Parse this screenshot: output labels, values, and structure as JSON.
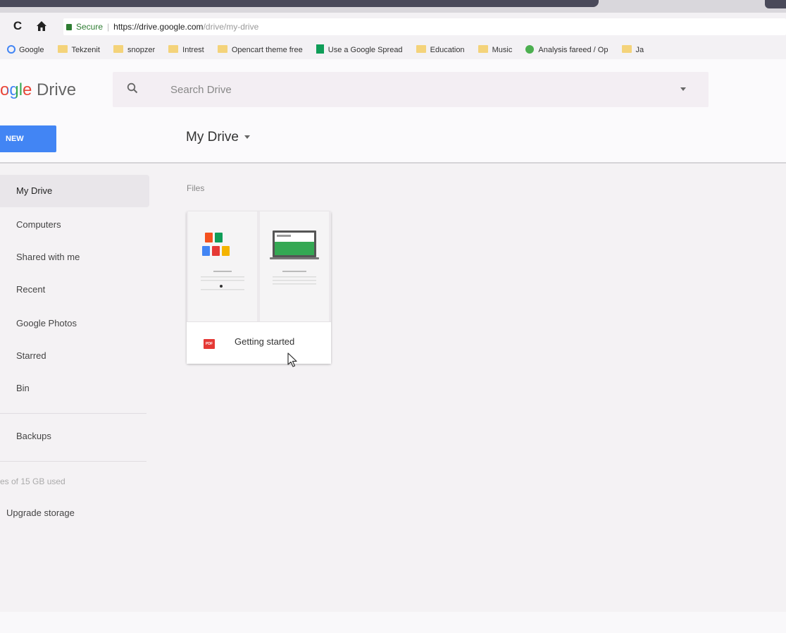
{
  "browser": {
    "secure_label": "Secure",
    "url_host": "https://drive.google.com",
    "url_path": "/drive/my-drive",
    "bookmarks": [
      {
        "label": "Google",
        "icon": "google-icon"
      },
      {
        "label": "Tekzenit",
        "icon": "folder-icon"
      },
      {
        "label": "snopzer",
        "icon": "folder-icon"
      },
      {
        "label": "Intrest",
        "icon": "folder-icon"
      },
      {
        "label": "Opencart theme free",
        "icon": "folder-icon"
      },
      {
        "label": "Use a Google Spread",
        "icon": "sheets-icon"
      },
      {
        "label": "Education",
        "icon": "folder-icon"
      },
      {
        "label": "Music",
        "icon": "folder-icon"
      },
      {
        "label": "Analysis fareed / Op",
        "icon": "app-icon"
      },
      {
        "label": "Ja",
        "icon": "folder-icon"
      }
    ]
  },
  "header": {
    "logo_partial": "ogle",
    "logo_product": "Drive",
    "search_placeholder": "Search Drive",
    "new_button": "NEW",
    "title": "My Drive"
  },
  "sidebar": {
    "items": [
      {
        "label": "My Drive",
        "active": true
      },
      {
        "label": "Computers"
      },
      {
        "label": "Shared with me"
      },
      {
        "label": "Recent"
      },
      {
        "label": "Google Photos"
      },
      {
        "label": "Starred"
      },
      {
        "label": "Bin"
      },
      {
        "label": "Backups"
      }
    ],
    "storage": "es of 15 GB used",
    "upgrade": "Upgrade storage"
  },
  "main": {
    "section_label": "Files",
    "files": [
      {
        "name": "Getting started",
        "type": "pdf",
        "type_badge": "PDF"
      }
    ]
  },
  "colors": {
    "accent": "#4285f4",
    "pdf": "#e53935",
    "secure": "#2e7d32"
  }
}
